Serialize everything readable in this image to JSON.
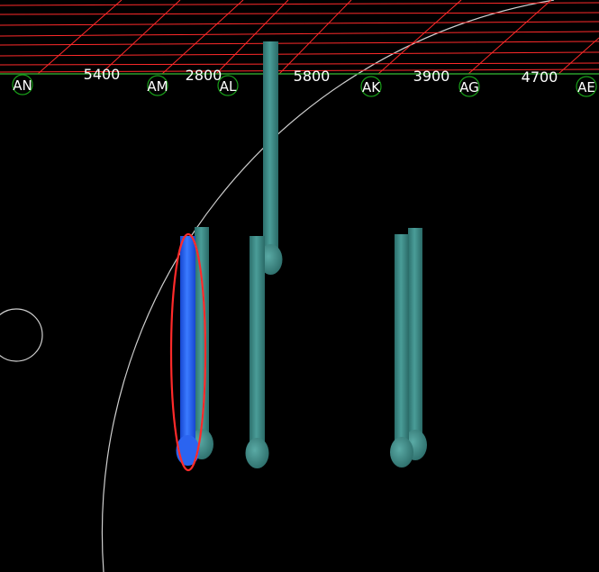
{
  "viewport": {
    "background": "#000000",
    "grid_color": "#ff2a2a",
    "axis_line_color": "#2a9d2a",
    "bubble_color": "#19a019",
    "pile_color": "#3a8a86",
    "selected_color": "#1f5fff",
    "selection_outline_color": "#ff2a2a",
    "cursor_guide_color": "#cfcfcf"
  },
  "axes": [
    {
      "id": "AN",
      "label": "AN"
    },
    {
      "id": "AM",
      "label": "AM"
    },
    {
      "id": "AL",
      "label": "AL"
    },
    {
      "id": "AK",
      "label": "AK"
    },
    {
      "id": "AG",
      "label": "AG"
    },
    {
      "id": "AE",
      "label": "AE"
    }
  ],
  "dimensions": [
    "5400",
    "2800",
    "5800",
    "3900",
    "4700"
  ],
  "piles": [
    {
      "id": "pile-1",
      "selected": true
    },
    {
      "id": "pile-2",
      "selected": false
    },
    {
      "id": "pile-3",
      "selected": false
    },
    {
      "id": "pile-4",
      "selected": false
    },
    {
      "id": "pile-5",
      "selected": false
    },
    {
      "id": "pile-6",
      "selected": false
    }
  ]
}
